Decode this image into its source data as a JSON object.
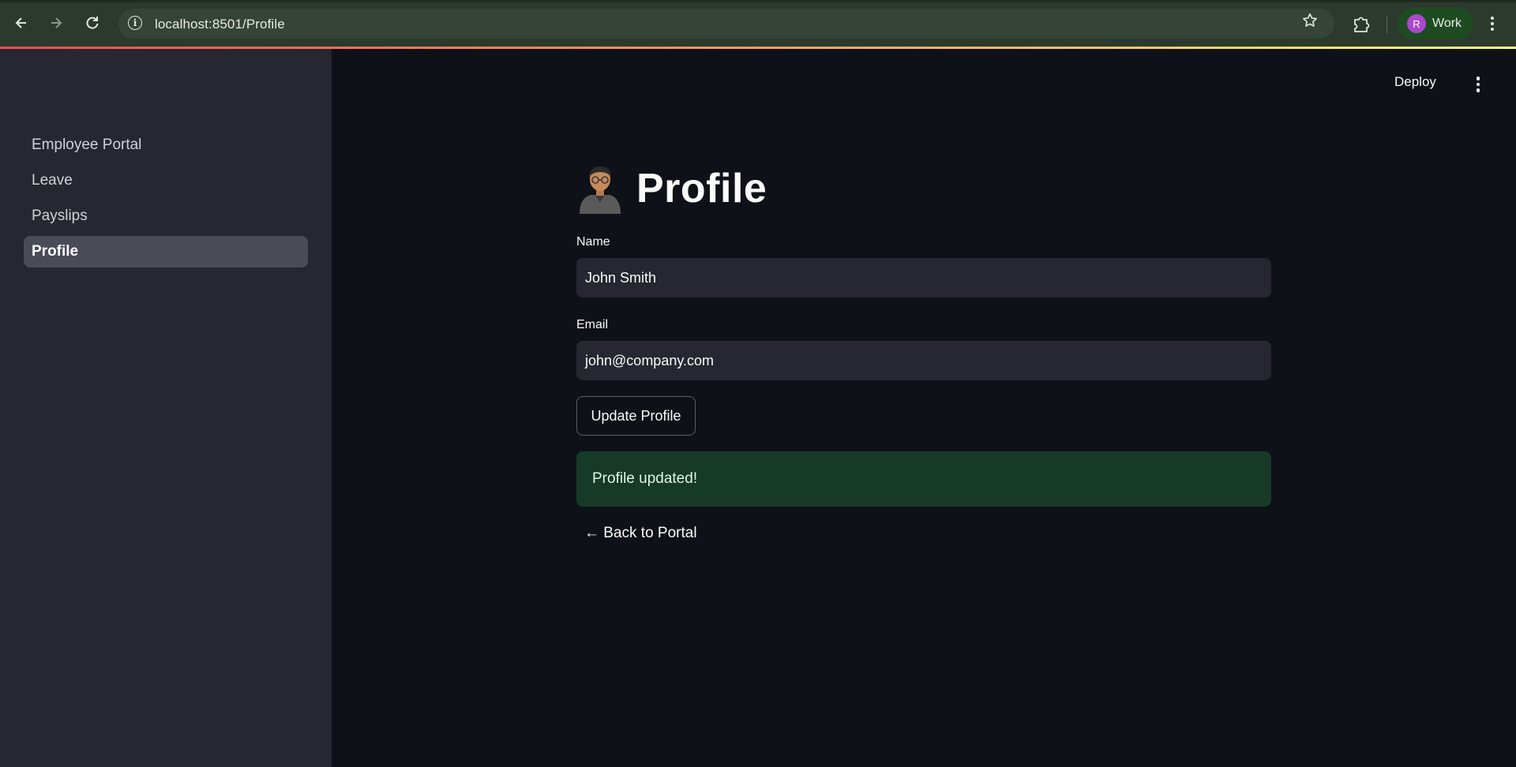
{
  "browser": {
    "url": "localhost:8501/Profile",
    "profile_initial": "R",
    "profile_label": "Work",
    "icons": [
      "back-arrow-icon",
      "forward-arrow-icon",
      "reload-icon",
      "site-info-icon",
      "bookmark-star-icon",
      "extensions-puzzle-icon",
      "more-vert-icon"
    ]
  },
  "app_header": {
    "deploy_label": "Deploy"
  },
  "sidebar": {
    "items": [
      {
        "label": "Employee Portal",
        "active": false
      },
      {
        "label": "Leave",
        "active": false
      },
      {
        "label": "Payslips",
        "active": false
      },
      {
        "label": "Profile",
        "active": true
      }
    ]
  },
  "main": {
    "title": "Profile",
    "title_icon": "office-worker-icon",
    "name": {
      "label": "Name",
      "value": "John Smith"
    },
    "email": {
      "label": "Email",
      "value": "john@company.com"
    },
    "update_button": "Update Profile",
    "success_message": "Profile updated!",
    "back_link": "← Back to Portal"
  },
  "colors": {
    "background": "#0e1117",
    "sidebar": "#262730",
    "input": "#262730",
    "success_bg": "#173928",
    "chrome": "#2b3a2c",
    "avatar": "#a849c9"
  }
}
